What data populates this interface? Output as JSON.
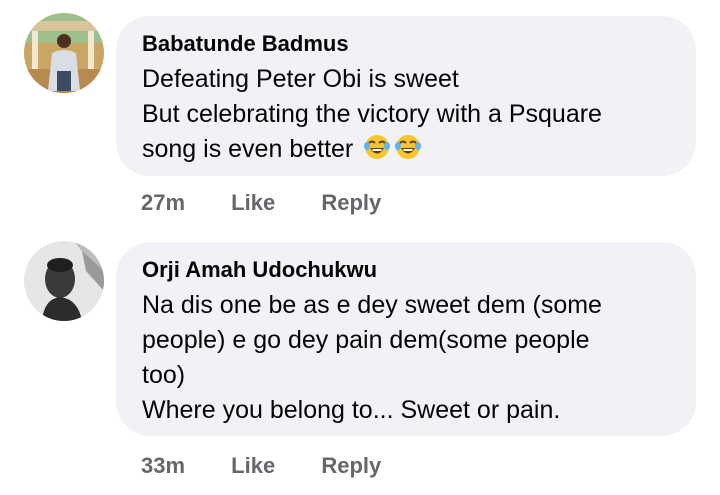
{
  "comments": [
    {
      "author": "Babatunde Badmus",
      "lines": [
        "Defeating Peter Obi is sweet",
        "But celebrating the victory with a Psquare",
        "song is even better"
      ],
      "emojis": [
        "tears-of-joy-emoji",
        "tears-of-joy-emoji"
      ],
      "timestamp": "27m",
      "like_label": "Like",
      "reply_label": "Reply"
    },
    {
      "author": "Orji Amah Udochukwu",
      "lines": [
        "Na dis one be as e dey sweet dem (some",
        "people) e go dey pain dem(some people",
        "too)",
        "Where you belong to... Sweet or pain."
      ],
      "timestamp": "33m",
      "like_label": "Like",
      "reply_label": "Reply"
    }
  ],
  "colors": {
    "bubble": "#f0f2f5",
    "text": "#050505",
    "meta": "#65676b"
  }
}
